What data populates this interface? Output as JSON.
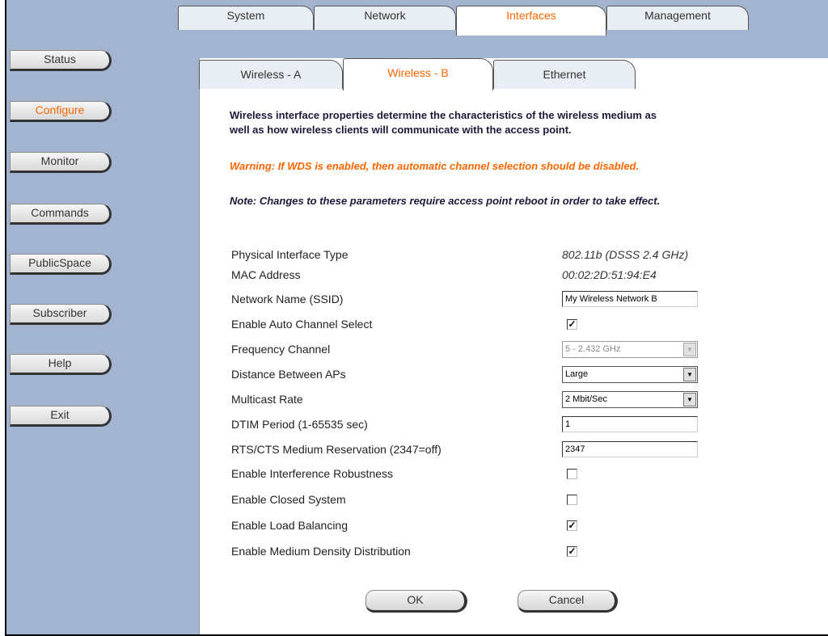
{
  "sidebar": {
    "items": [
      {
        "label": "Status"
      },
      {
        "label": "Configure"
      },
      {
        "label": "Monitor"
      },
      {
        "label": "Commands"
      },
      {
        "label": "PublicSpace"
      },
      {
        "label": "Subscriber"
      },
      {
        "label": "Help"
      },
      {
        "label": "Exit"
      }
    ],
    "active": "Configure"
  },
  "top_tabs": {
    "items": [
      {
        "label": "System"
      },
      {
        "label": "Network"
      },
      {
        "label": "Interfaces"
      },
      {
        "label": "Management"
      }
    ],
    "active": "Interfaces"
  },
  "sub_tabs": {
    "items": [
      {
        "label": "Wireless - A"
      },
      {
        "label": "Wireless - B"
      },
      {
        "label": "Ethernet"
      }
    ],
    "active": "Wireless - B"
  },
  "intro": {
    "line1": "Wireless interface properties determine the characteristics of the wireless medium as",
    "line2": "well as how wireless clients will communicate with the access point."
  },
  "warning": "Warning: If WDS is enabled, then automatic channel selection should be disabled.",
  "note": "Note: Changes to these parameters require access point reboot in order to take effect.",
  "fields": {
    "physical_interface_type": {
      "label": "Physical Interface Type",
      "value": "802.11b (DSSS 2.4 GHz)"
    },
    "mac_address": {
      "label": "MAC Address",
      "value": "00:02:2D:51:94:E4"
    },
    "network_name": {
      "label": "Network Name (SSID)",
      "value": "My Wireless Network B"
    },
    "auto_channel": {
      "label": "Enable Auto Channel Select",
      "checked": true
    },
    "frequency_channel": {
      "label": "Frequency Channel",
      "value": "5 - 2.432 GHz",
      "disabled": true
    },
    "distance": {
      "label": "Distance Between APs",
      "value": "Large"
    },
    "multicast_rate": {
      "label": "Multicast Rate",
      "value": "2 Mbit/Sec"
    },
    "dtim_period": {
      "label": "DTIM Period (1-65535 sec)",
      "value": "1"
    },
    "rts_cts": {
      "label": "RTS/CTS Medium Reservation (2347=off)",
      "value": "2347"
    },
    "interference_robustness": {
      "label": "Enable Interference Robustness",
      "checked": false
    },
    "closed_system": {
      "label": "Enable Closed System",
      "checked": false
    },
    "load_balancing": {
      "label": "Enable Load Balancing",
      "checked": true
    },
    "medium_density": {
      "label": "Enable Medium Density Distribution",
      "checked": true
    }
  },
  "buttons": {
    "ok": "OK",
    "cancel": "Cancel"
  },
  "colors": {
    "sidebar_bg": "#a3b4d1",
    "accent": "#ff6600",
    "heading_text": "#1a1a3a"
  }
}
